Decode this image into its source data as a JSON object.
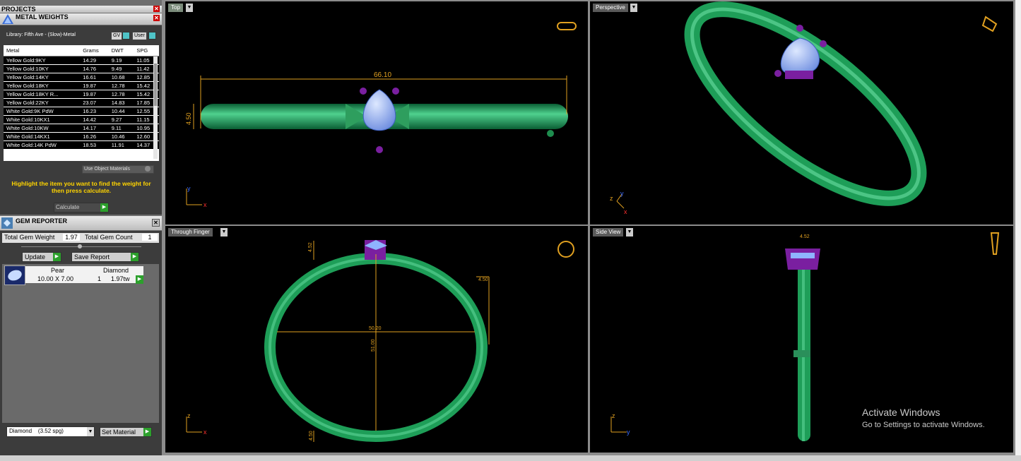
{
  "projects": {
    "title": "PROJECTS"
  },
  "metal_weights": {
    "title": "METAL WEIGHTS",
    "library": "Library: Fifth Ave - (Slow)-Metal",
    "gv_label": "GV",
    "user_label": "User",
    "columns": [
      "Metal",
      "Grams",
      "DWT",
      "SPG"
    ],
    "rows": [
      [
        "Yellow Gold:9KY",
        "14.29",
        "9.19",
        "11.05"
      ],
      [
        "Yellow Gold:10KY",
        "14.76",
        "9.49",
        "11.42"
      ],
      [
        "Yellow Gold:14KY",
        "16.61",
        "10.68",
        "12.85"
      ],
      [
        "Yellow Gold:18KY",
        "19.87",
        "12.78",
        "15.42"
      ],
      [
        "Yellow Gold:18KY R...",
        "19.87",
        "12.78",
        "15.42"
      ],
      [
        "Yellow Gold:22KY",
        "23.07",
        "14.83",
        "17.85"
      ],
      [
        "White Gold:9K PdW",
        "16.23",
        "10.44",
        "12.55"
      ],
      [
        "White Gold:10KX1",
        "14.42",
        "9.27",
        "11.15"
      ],
      [
        "White Gold:10KW",
        "14.17",
        "9.11",
        "10.95"
      ],
      [
        "White Gold:14KX1",
        "16.26",
        "10.46",
        "12.60"
      ],
      [
        "White Gold:14K PdW",
        "18.53",
        "11.91",
        "14.37"
      ]
    ],
    "use_object_materials": "Use Object Materials",
    "hint": "Highlight the item you want to find the weight for then press calculate.",
    "calculate": "Calculate"
  },
  "gem_reporter": {
    "title": "GEM REPORTER",
    "total_weight_label": "Total Gem Weight",
    "total_weight": "1.97",
    "total_count_label": "Total Gem Count",
    "total_count": "1",
    "update": "Update",
    "save_report": "Save Report",
    "gem": {
      "shape": "Pear",
      "size": "10.00 X 7.00",
      "material": "Diamond",
      "count": "1",
      "weight": "1.97tw"
    },
    "material_select": "Diamond    (3.52 spg)",
    "set_material": "Set Material"
  },
  "viewports": {
    "top": {
      "label": "Top",
      "dim_length": "66.10",
      "dim_height": "4.50"
    },
    "perspective": {
      "label": "Perspective"
    },
    "through_finger": {
      "label": "Through Finger",
      "dim_top": "4.52",
      "dim_side": "4.50",
      "dim_width": "50.20",
      "dim_height": "51.00",
      "dim_bottom": "4.50"
    },
    "side_view": {
      "label": "Side View",
      "dim_top": "4.52"
    }
  },
  "axes": {
    "x": "x",
    "y": "y",
    "z": "z"
  },
  "watermark": {
    "line1": "Activate Windows",
    "line2": "Go to Settings to activate Windows."
  },
  "colors": {
    "ring_green": "#1fa866",
    "gem_blue": "#8fb4ff",
    "prong_purple": "#7a1fa0",
    "dimension_orange": "#e0a020"
  }
}
